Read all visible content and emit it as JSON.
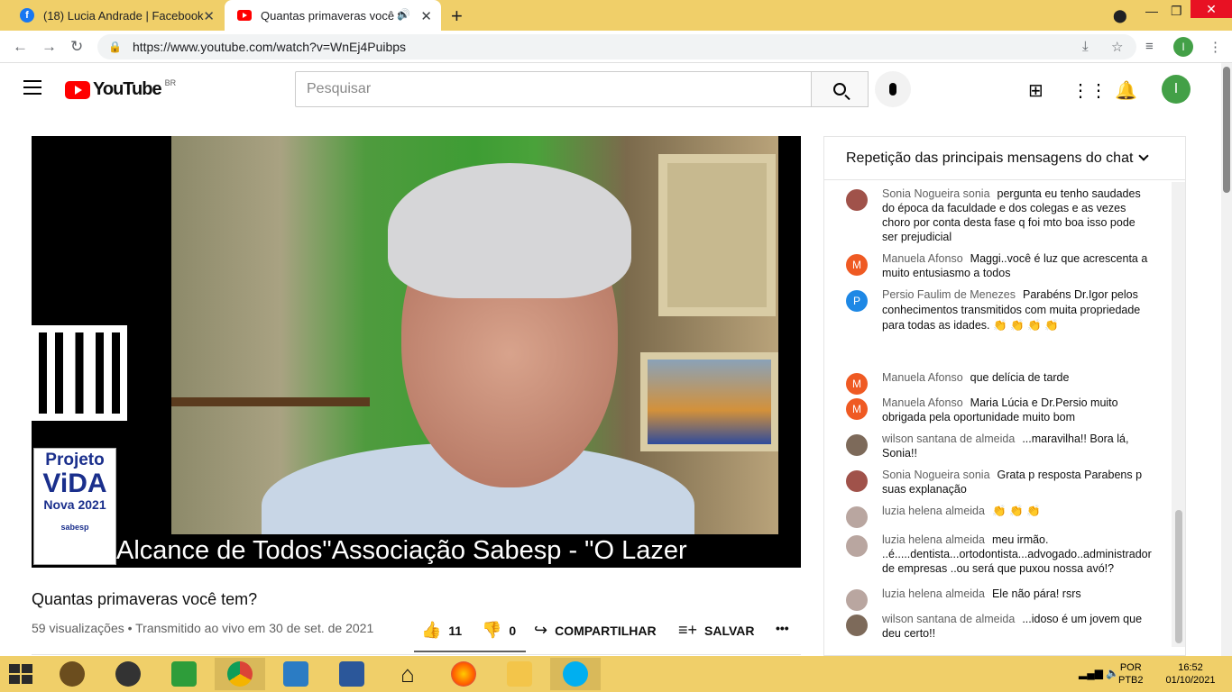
{
  "browser": {
    "tabs": [
      {
        "title": "(18) Lucia Andrade | Facebook",
        "icon": "facebook-icon",
        "active": false
      },
      {
        "title": "Quantas primaveras você tem",
        "icon": "youtube-icon",
        "active": true
      }
    ],
    "url": "https://www.youtube.com/watch?v=WnEj4Puibps",
    "profile_initial": "I"
  },
  "youtube": {
    "logo_text": "YouTube",
    "country_code": "BR",
    "search_placeholder": "Pesquisar",
    "avatar_initial": "I"
  },
  "video": {
    "ticker_text": "Alcance de Todos\"Associação Sabesp - \"O Lazer",
    "logo": {
      "line1": "Projeto",
      "line2": "ViDA",
      "line3": "Nova 2021",
      "line4": "sabesp"
    },
    "title": "Quantas primaveras você tem?",
    "stats": "59 visualizações • Transmitido ao vivo em 30 de set. de 2021",
    "likes": "11",
    "dislikes": "0",
    "share_label": "COMPARTILHAR",
    "save_label": "SALVAR",
    "more_label": "•••"
  },
  "chat": {
    "header": "Repetição das principais mensagens do chat",
    "messages": [
      {
        "author": "Sonia Nogueira sonia",
        "text": "pergunta eu tenho saudades do época da faculdade e dos colegas e as vezes choro por conta desta fase q foi mto boa isso pode ser prejudicial",
        "avatar": "photo",
        "color": "#a0524a"
      },
      {
        "author": "Manuela Afonso",
        "text": "Maggi..você é luz que acrescenta a muito entusiasmo a todos",
        "avatar": "M",
        "color": "#ef5a23"
      },
      {
        "author": "Persio Faulim de Menezes",
        "text": "Parabéns Dr.Igor pelos conhecimentos transmitidos com muita propriedade para todas as idades. 👏 👏 👏 👏",
        "avatar": "P",
        "color": "#1e88e5"
      },
      {
        "author": "Manuela Afonso",
        "text": "que delícia de tarde",
        "avatar": "M",
        "color": "#ef5a23"
      },
      {
        "author": "Manuela Afonso",
        "text": "Maria Lúcia e Dr.Persio muito obrigada pela oportunidade muito bom",
        "avatar": "M",
        "color": "#ef5a23"
      },
      {
        "author": "wilson santana de almeida",
        "text": "...maravilha!! Bora lá, Sonia!!",
        "avatar": "photo",
        "color": "#7d6a5a"
      },
      {
        "author": "Sonia Nogueira sonia",
        "text": "Grata p resposta Parabens p suas explanação",
        "avatar": "photo",
        "color": "#a0524a"
      },
      {
        "author": "luzia helena almeida",
        "text": "👏 👏 👏",
        "avatar": "photo",
        "color": "#b9a6a0"
      },
      {
        "author": "luzia helena almeida",
        "text": "meu irmão. ..é.....dentista...ortodontista...advogado..administrador de empresas ..ou será que puxou nossa avó!?",
        "avatar": "photo",
        "color": "#b9a6a0"
      },
      {
        "author": "luzia helena almeida",
        "text": "Ele não pára! rsrs",
        "avatar": "photo",
        "color": "#b9a6a0"
      },
      {
        "author": "wilson santana de almeida",
        "text": "...idoso é um jovem que deu certo!!",
        "avatar": "photo",
        "color": "#7d6a5a"
      }
    ]
  },
  "taskbar": {
    "lang1": "POR",
    "lang2": "PTB2",
    "time": "16:52",
    "date": "01/10/2021"
  }
}
